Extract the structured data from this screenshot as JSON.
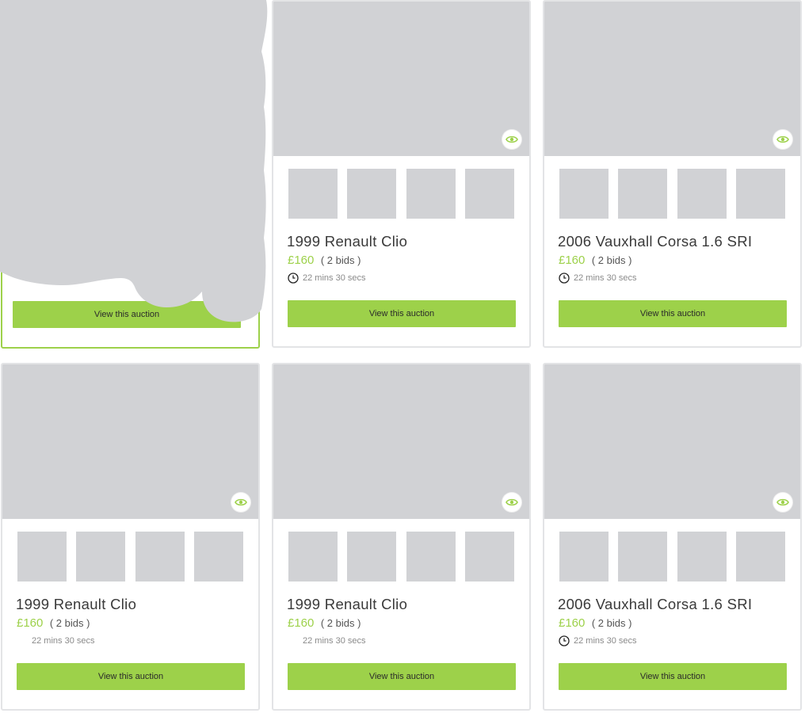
{
  "cards": [
    {
      "title": "",
      "price": "",
      "bids": "",
      "time": "",
      "button": "View this auction",
      "active": true
    },
    {
      "title": "1999 Renault Clio",
      "price": "£160",
      "bids": "( 2 bids )",
      "time": "22 mins 30 secs",
      "button": "View this auction"
    },
    {
      "title": "2006 Vauxhall Corsa 1.6 SRI",
      "price": "£160",
      "bids": "( 2 bids )",
      "time": "22 mins 30 secs",
      "button": "View this auction"
    },
    {
      "title": "1999 Renault Clio",
      "price": "£160",
      "bids": "( 2 bids )",
      "time": "22 mins 30 secs",
      "button": "View this auction"
    },
    {
      "title": "1999 Renault Clio",
      "price": "£160",
      "bids": "( 2 bids )",
      "time": "22 mins 30 secs",
      "button": "View this auction"
    },
    {
      "title": "2006 Vauxhall Corsa 1.6 SRI",
      "price": "£160",
      "bids": "( 2 bids )",
      "time": "22 mins 30 secs",
      "button": "View this auction"
    }
  ],
  "colors": {
    "accent": "#9dd14a",
    "placeholder": "#d1d2d5",
    "border": "#e3e4e6"
  },
  "icons": {
    "watch": "eye-icon",
    "time": "clock-icon"
  }
}
